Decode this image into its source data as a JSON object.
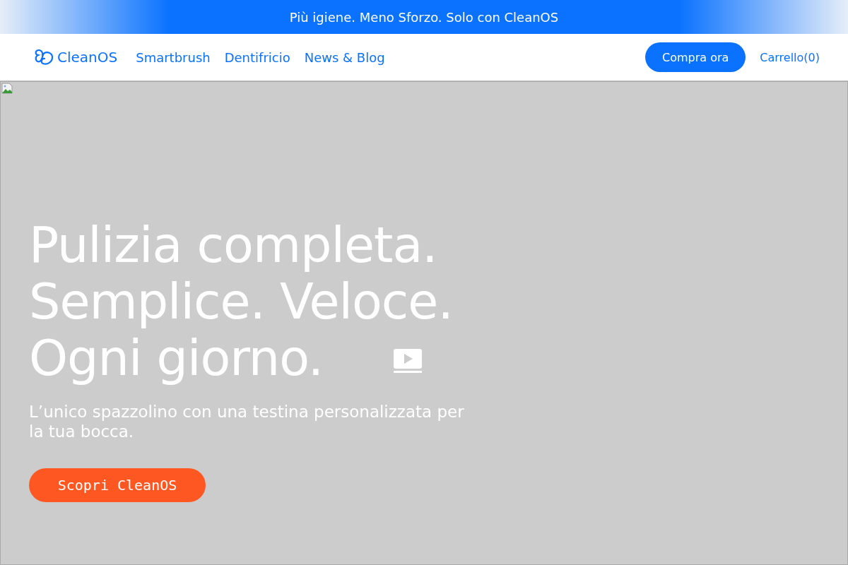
{
  "announcement": "Più igiene. Meno Sforzo. Solo con CleanOS",
  "nav": {
    "logo": "CleanOS",
    "links": [
      "Smartbrush",
      "Dentifricio",
      "News & Blog"
    ],
    "cta": "Compra ora",
    "cart": "Carrello(0)"
  },
  "hero": {
    "heading_lines": [
      "Pulizia completa.",
      "Semplice. Veloce.",
      "Ogni giorno."
    ],
    "subtitle": "L’unico spazzolino con una testina personalizzata per la tua bocca.",
    "button": "Scopri CleanOS"
  }
}
